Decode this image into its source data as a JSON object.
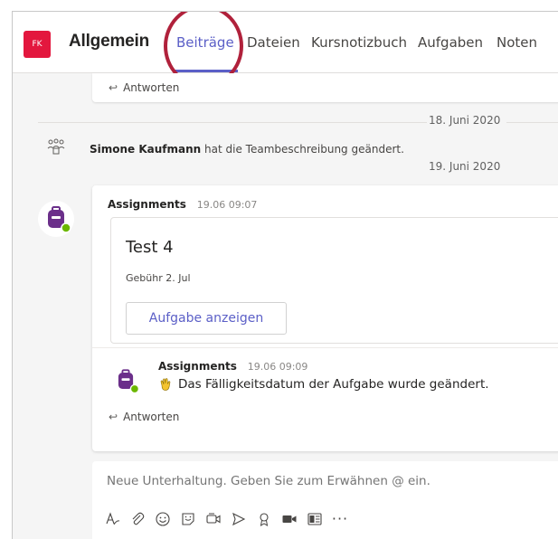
{
  "header": {
    "team_initials": "FK",
    "channel_name": "Allgemein",
    "tabs": [
      {
        "label": "Beiträge",
        "active": true
      },
      {
        "label": "Dateien",
        "active": false
      },
      {
        "label": "Kursnotizbuch",
        "active": false
      },
      {
        "label": "Aufgaben",
        "active": false
      },
      {
        "label": "Noten",
        "active": false
      }
    ]
  },
  "feed": {
    "reply_label": "Antworten",
    "date_1": "18. Juni 2020",
    "event": {
      "actor": "Simone Kaufmann",
      "action": "hat die Teambeschreibung geändert."
    },
    "date_2": "19. Juni 2020",
    "post": {
      "sender": "Assignments",
      "time": "19.06 09:07",
      "card": {
        "title": "Test 4",
        "due": "Gebühr 2. Jul",
        "button_label": "Aufgabe anzeigen"
      }
    },
    "reply": {
      "sender": "Assignments",
      "time": "19.06 09:09",
      "text": "Das Fälligkeitsdatum der Aufgabe wurde geändert."
    }
  },
  "compose": {
    "placeholder": "Neue Unterhaltung. Geben Sie zum Erwähnen @ ein.",
    "more_label": "···"
  },
  "colors": {
    "accent": "#5b5fc7",
    "team_avatar": "#e3173e",
    "highlight_circle": "#b0213b",
    "assignments_purple": "#6b2f8a",
    "presence_green": "#6bb700"
  },
  "icons": {
    "toolbar": [
      "format-icon",
      "attach-icon",
      "emoji-icon",
      "sticker-icon",
      "meet-icon",
      "send-icon",
      "praise-icon",
      "video-icon",
      "whiteboard-icon",
      "more-icon"
    ]
  }
}
